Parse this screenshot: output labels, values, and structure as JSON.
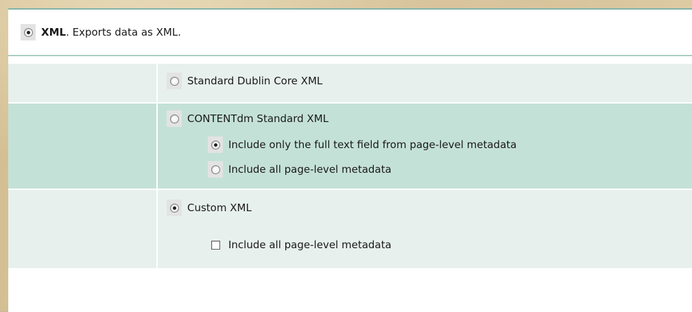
{
  "xml_option": {
    "title": "XML",
    "description": ". Exports data as XML.",
    "selected": true
  },
  "options": [
    {
      "label": "Standard Dublin Core XML",
      "selected": false,
      "suboptions": []
    },
    {
      "label": "CONTENTdm Standard XML",
      "selected": false,
      "suboptions": [
        {
          "label": "Include only the full text field from page-level metadata",
          "type": "radio",
          "selected": true
        },
        {
          "label": "Include all page-level metadata",
          "type": "radio",
          "selected": false
        }
      ]
    },
    {
      "label": "Custom XML",
      "selected": true,
      "suboptions": [
        {
          "label": "Include all page-level metadata",
          "type": "checkbox",
          "selected": false
        }
      ]
    }
  ]
}
